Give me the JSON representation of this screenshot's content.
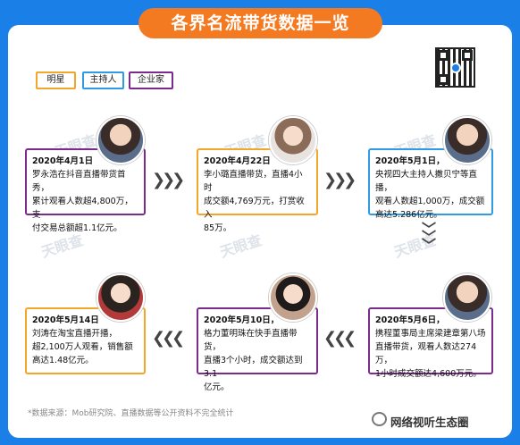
{
  "title": "各界名流带货数据一览",
  "legend": {
    "star": "明星",
    "host": "主持人",
    "entrepreneur": "企业家"
  },
  "colors": {
    "background": "#1a7fe6",
    "title_bg": "#f47a21",
    "star": "#f3a72a",
    "host": "#2f9be5",
    "entrepreneur": "#7d2a8f"
  },
  "watermark": "天眼查",
  "events": [
    {
      "date": "2020年4月1日",
      "category": "entrepreneur",
      "lines": [
        "罗永浩在抖音直播带货首秀，",
        "累计观看人数超4,800万，支",
        "付交易总额超1.1亿元。"
      ]
    },
    {
      "date": "2020年4月22日",
      "category": "star",
      "lines": [
        "李小璐直播带货，直播4小时",
        "成交额4,769万元，打赏收入",
        "85万。"
      ]
    },
    {
      "date": "2020年5月1日，",
      "category": "host",
      "lines": [
        "央视四大主持人撒贝宁等直播，",
        "观看人数超1,000万，成交额",
        "高达5.286亿元。"
      ]
    },
    {
      "date": "2020年5月14日",
      "category": "star",
      "lines": [
        "刘涛在淘宝直播开播，",
        "超2,100万人观看，销售额",
        "高达1.48亿元。"
      ]
    },
    {
      "date": "2020年5月10日，",
      "category": "entrepreneur",
      "lines": [
        "格力董明珠在快手直播带货，",
        "直播3个小时，成交额达到3.1",
        "亿元。"
      ]
    },
    {
      "date": "2020年5月6日，",
      "category": "entrepreneur",
      "lines": [
        "携程董事局主席梁建章第八场",
        "直播带货，观看人数达274万，",
        "1小时成交额达4,600万元。"
      ]
    }
  ],
  "footnote": "*数据来源：Mob研究院、直播数据等公开资料不完全统计",
  "brand": "网络视听生态圈"
}
